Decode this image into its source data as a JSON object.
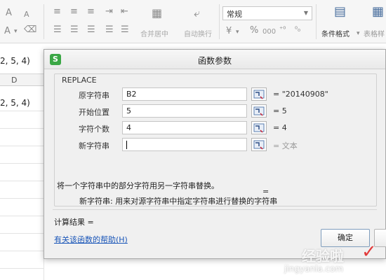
{
  "ribbon": {
    "font_size_up": "A",
    "font_size_down": "A",
    "font_color_label": "A",
    "number_style": "常规",
    "percent_symbol": "%",
    "thousands_symbol": "000",
    "merge_center_label": "合并居中",
    "auto_wrap_label": "自动换行",
    "conditional_format_label": "条件格式",
    "table_style_label": "表格样"
  },
  "sheet": {
    "formula_text": "2, 5, 4)",
    "column_d": "D",
    "cell_text": "2, 5, 4)"
  },
  "dialog": {
    "title": "函数参数",
    "function_name": "REPLACE",
    "args": [
      {
        "label": "原字符串",
        "value": "B2",
        "result": "= \"20140908\""
      },
      {
        "label": "开始位置",
        "value": "5",
        "result": "= 5"
      },
      {
        "label": "字符个数",
        "value": "4",
        "result": "= 4"
      },
      {
        "label": "新字符串",
        "value": "",
        "result": "= 文本"
      }
    ],
    "formula_result": "=",
    "description": "将一个字符串中的部分字符用另一字符串替换。",
    "param_description": "新字符串:   用来对源字符串中指定字符串进行替换的字符串",
    "calc_result": "计算结果  =",
    "help_link": "有关该函数的帮助(H)",
    "ok_label": "确定"
  },
  "watermark": {
    "main": "经验啦",
    "sub": "jingyanla.com",
    "check": "✓"
  },
  "colors": {
    "app_icon": "#3aa745",
    "link": "#1a56b8"
  }
}
